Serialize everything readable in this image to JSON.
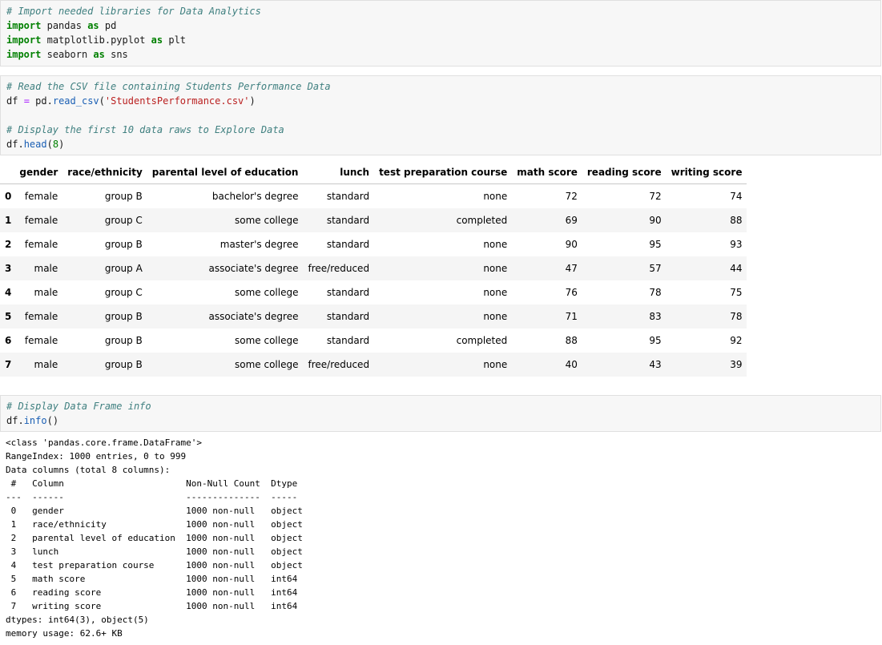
{
  "cell1": {
    "comment": "# Import needed libraries for Data Analytics",
    "lines": [
      {
        "kw1": "import",
        "mod": "pandas",
        "kw2": "as",
        "alias": "pd"
      },
      {
        "kw1": "import",
        "mod": "matplotlib.pyplot",
        "kw2": "as",
        "alias": "plt"
      },
      {
        "kw1": "import",
        "mod": "seaborn",
        "kw2": "as",
        "alias": "sns"
      }
    ]
  },
  "cell2": {
    "comment1": "# Read the CSV file containing Students Performance Data",
    "assign_var": "df",
    "assign_op": "=",
    "assign_obj": "pd.",
    "assign_fn": "read_csv",
    "assign_arg": "'StudentsPerformance.csv'",
    "comment2": "# Display the first 10 data raws to Explore Data",
    "head_obj": "df.",
    "head_fn": "head",
    "head_arg": "8"
  },
  "table": {
    "columns": [
      "gender",
      "race/ethnicity",
      "parental level of education",
      "lunch",
      "test preparation course",
      "math score",
      "reading score",
      "writing score"
    ],
    "rows": [
      {
        "index": "0",
        "cells": [
          "female",
          "group B",
          "bachelor's degree",
          "standard",
          "none",
          "72",
          "72",
          "74"
        ]
      },
      {
        "index": "1",
        "cells": [
          "female",
          "group C",
          "some college",
          "standard",
          "completed",
          "69",
          "90",
          "88"
        ]
      },
      {
        "index": "2",
        "cells": [
          "female",
          "group B",
          "master's degree",
          "standard",
          "none",
          "90",
          "95",
          "93"
        ]
      },
      {
        "index": "3",
        "cells": [
          "male",
          "group A",
          "associate's degree",
          "free/reduced",
          "none",
          "47",
          "57",
          "44"
        ]
      },
      {
        "index": "4",
        "cells": [
          "male",
          "group C",
          "some college",
          "standard",
          "none",
          "76",
          "78",
          "75"
        ]
      },
      {
        "index": "5",
        "cells": [
          "female",
          "group B",
          "associate's degree",
          "standard",
          "none",
          "71",
          "83",
          "78"
        ]
      },
      {
        "index": "6",
        "cells": [
          "female",
          "group B",
          "some college",
          "standard",
          "completed",
          "88",
          "95",
          "92"
        ]
      },
      {
        "index": "7",
        "cells": [
          "male",
          "group B",
          "some college",
          "free/reduced",
          "none",
          "40",
          "43",
          "39"
        ]
      }
    ]
  },
  "cell3": {
    "comment": "# Display Data Frame info",
    "obj": "df.",
    "fn": "info",
    "parens": "()"
  },
  "info_output": "<class 'pandas.core.frame.DataFrame'>\nRangeIndex: 1000 entries, 0 to 999\nData columns (total 8 columns):\n #   Column                       Non-Null Count  Dtype \n---  ------                       --------------  ----- \n 0   gender                       1000 non-null   object\n 1   race/ethnicity               1000 non-null   object\n 2   parental level of education  1000 non-null   object\n 3   lunch                        1000 non-null   object\n 4   test preparation course      1000 non-null   object\n 5   math score                   1000 non-null   int64 \n 6   reading score                1000 non-null   int64 \n 7   writing score                1000 non-null   int64 \ndtypes: int64(3), object(5)\nmemory usage: 62.6+ KB"
}
